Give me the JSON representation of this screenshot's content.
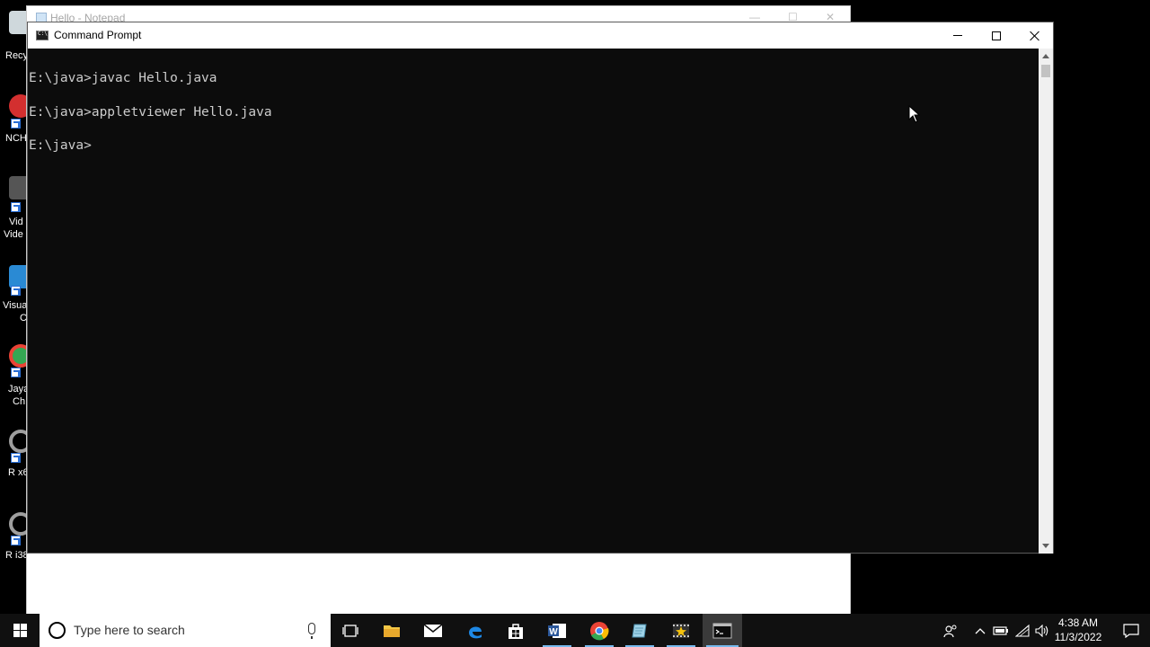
{
  "desktop": {
    "icons": [
      {
        "label": "Recy",
        "color": "#cfd8dc"
      },
      {
        "label": "NCH",
        "color": "#d32f2f"
      },
      {
        "label": "Vid",
        "label2": "Vide",
        "color": "#555555"
      },
      {
        "label": "Visua",
        "label2": "C",
        "color": "#2a8ad4"
      },
      {
        "label": "Jaya",
        "label2": "Ch",
        "color": "#34a853"
      },
      {
        "label": "R x6",
        "color": "#9e9e9e"
      },
      {
        "label": "R i38",
        "color": "#9e9e9e"
      }
    ]
  },
  "notepad": {
    "title": "Hello - Notepad",
    "minimize": "—",
    "maximize": "☐",
    "close": "✕"
  },
  "cmd": {
    "title": "Command Prompt",
    "lines": [
      "E:\\java>javac Hello.java",
      "E:\\java>appletviewer Hello.java",
      "E:\\java>"
    ]
  },
  "taskbar": {
    "search_placeholder": "Type here to search",
    "time": "4:38 AM",
    "date": "11/3/2022"
  }
}
